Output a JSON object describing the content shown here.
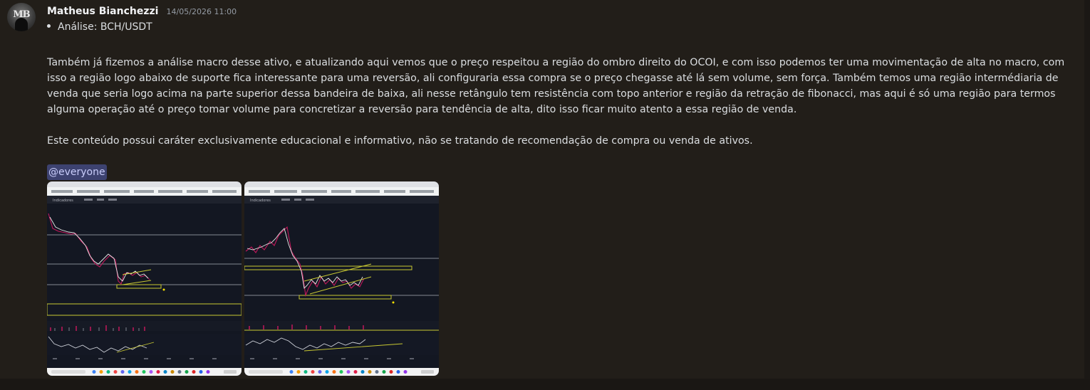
{
  "message": {
    "author": "Matheus Bianchezzi",
    "timestamp": "14/05/2026 11:00",
    "avatar_text": "MB",
    "bullet": "Análise: BCH/USDT",
    "paragraph_1": "Também já fizemos a análise macro desse ativo, e atualizando aqui vemos que o preço respeitou a região do ombro direito do OCOI, e com isso podemos ter uma movimentação de alta no macro, com isso a região logo abaixo de suporte fica interessante para uma reversão, ali configuraria essa compra se o preço chegasse até lá sem volume, sem força. Também temos uma região intermédiaria de venda que seria logo acima na parte superior dessa bandeira de baixa, ali nesse retângulo tem resistência com topo anterior e região da retração de fibonacci, mas aqui é só uma região para termos alguma operação até o preço tomar volume para concretizar a reversão para tendência de alta, dito isso ficar muito atento a essa região de venda.",
    "paragraph_2": "Este conteúdo possui caráter exclusivamente educacional e informativo, não se tratando de recomendação de compra ou venda de ativos.",
    "mention": "@everyone"
  },
  "attachments": [
    {
      "name": "chart-screenshot-1",
      "toolbar_label": "Indicadores"
    },
    {
      "name": "chart-screenshot-2",
      "toolbar_label": "Indicadores"
    }
  ],
  "colors": {
    "background": "#221e19",
    "mention_bg": "#3d4270",
    "chart_bg": "#131722",
    "candle_up": "#e8e8e8",
    "candle_down": "#c2185b",
    "zone_yellow": "#c8c832"
  }
}
